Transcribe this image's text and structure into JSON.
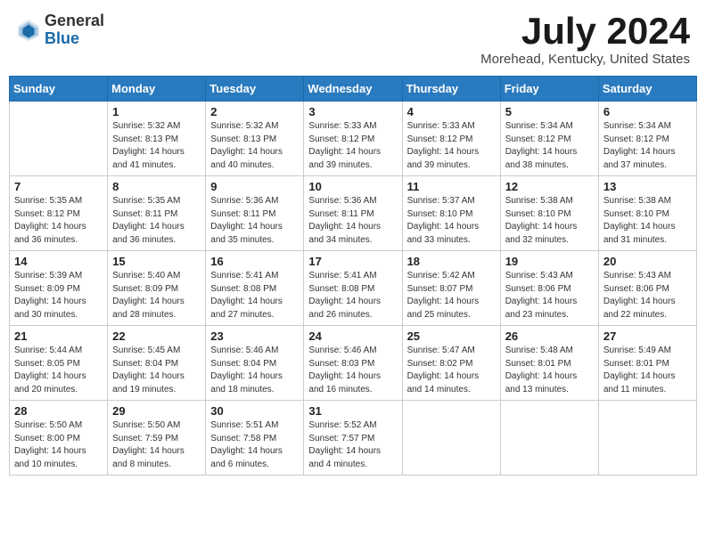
{
  "header": {
    "logo_general": "General",
    "logo_blue": "Blue",
    "month_title": "July 2024",
    "location": "Morehead, Kentucky, United States"
  },
  "days_of_week": [
    "Sunday",
    "Monday",
    "Tuesday",
    "Wednesday",
    "Thursday",
    "Friday",
    "Saturday"
  ],
  "weeks": [
    [
      {
        "day": "",
        "info": ""
      },
      {
        "day": "1",
        "info": "Sunrise: 5:32 AM\nSunset: 8:13 PM\nDaylight: 14 hours\nand 41 minutes."
      },
      {
        "day": "2",
        "info": "Sunrise: 5:32 AM\nSunset: 8:13 PM\nDaylight: 14 hours\nand 40 minutes."
      },
      {
        "day": "3",
        "info": "Sunrise: 5:33 AM\nSunset: 8:12 PM\nDaylight: 14 hours\nand 39 minutes."
      },
      {
        "day": "4",
        "info": "Sunrise: 5:33 AM\nSunset: 8:12 PM\nDaylight: 14 hours\nand 39 minutes."
      },
      {
        "day": "5",
        "info": "Sunrise: 5:34 AM\nSunset: 8:12 PM\nDaylight: 14 hours\nand 38 minutes."
      },
      {
        "day": "6",
        "info": "Sunrise: 5:34 AM\nSunset: 8:12 PM\nDaylight: 14 hours\nand 37 minutes."
      }
    ],
    [
      {
        "day": "7",
        "info": "Sunrise: 5:35 AM\nSunset: 8:12 PM\nDaylight: 14 hours\nand 36 minutes."
      },
      {
        "day": "8",
        "info": "Sunrise: 5:35 AM\nSunset: 8:11 PM\nDaylight: 14 hours\nand 36 minutes."
      },
      {
        "day": "9",
        "info": "Sunrise: 5:36 AM\nSunset: 8:11 PM\nDaylight: 14 hours\nand 35 minutes."
      },
      {
        "day": "10",
        "info": "Sunrise: 5:36 AM\nSunset: 8:11 PM\nDaylight: 14 hours\nand 34 minutes."
      },
      {
        "day": "11",
        "info": "Sunrise: 5:37 AM\nSunset: 8:10 PM\nDaylight: 14 hours\nand 33 minutes."
      },
      {
        "day": "12",
        "info": "Sunrise: 5:38 AM\nSunset: 8:10 PM\nDaylight: 14 hours\nand 32 minutes."
      },
      {
        "day": "13",
        "info": "Sunrise: 5:38 AM\nSunset: 8:10 PM\nDaylight: 14 hours\nand 31 minutes."
      }
    ],
    [
      {
        "day": "14",
        "info": "Sunrise: 5:39 AM\nSunset: 8:09 PM\nDaylight: 14 hours\nand 30 minutes."
      },
      {
        "day": "15",
        "info": "Sunrise: 5:40 AM\nSunset: 8:09 PM\nDaylight: 14 hours\nand 28 minutes."
      },
      {
        "day": "16",
        "info": "Sunrise: 5:41 AM\nSunset: 8:08 PM\nDaylight: 14 hours\nand 27 minutes."
      },
      {
        "day": "17",
        "info": "Sunrise: 5:41 AM\nSunset: 8:08 PM\nDaylight: 14 hours\nand 26 minutes."
      },
      {
        "day": "18",
        "info": "Sunrise: 5:42 AM\nSunset: 8:07 PM\nDaylight: 14 hours\nand 25 minutes."
      },
      {
        "day": "19",
        "info": "Sunrise: 5:43 AM\nSunset: 8:06 PM\nDaylight: 14 hours\nand 23 minutes."
      },
      {
        "day": "20",
        "info": "Sunrise: 5:43 AM\nSunset: 8:06 PM\nDaylight: 14 hours\nand 22 minutes."
      }
    ],
    [
      {
        "day": "21",
        "info": "Sunrise: 5:44 AM\nSunset: 8:05 PM\nDaylight: 14 hours\nand 20 minutes."
      },
      {
        "day": "22",
        "info": "Sunrise: 5:45 AM\nSunset: 8:04 PM\nDaylight: 14 hours\nand 19 minutes."
      },
      {
        "day": "23",
        "info": "Sunrise: 5:46 AM\nSunset: 8:04 PM\nDaylight: 14 hours\nand 18 minutes."
      },
      {
        "day": "24",
        "info": "Sunrise: 5:46 AM\nSunset: 8:03 PM\nDaylight: 14 hours\nand 16 minutes."
      },
      {
        "day": "25",
        "info": "Sunrise: 5:47 AM\nSunset: 8:02 PM\nDaylight: 14 hours\nand 14 minutes."
      },
      {
        "day": "26",
        "info": "Sunrise: 5:48 AM\nSunset: 8:01 PM\nDaylight: 14 hours\nand 13 minutes."
      },
      {
        "day": "27",
        "info": "Sunrise: 5:49 AM\nSunset: 8:01 PM\nDaylight: 14 hours\nand 11 minutes."
      }
    ],
    [
      {
        "day": "28",
        "info": "Sunrise: 5:50 AM\nSunset: 8:00 PM\nDaylight: 14 hours\nand 10 minutes."
      },
      {
        "day": "29",
        "info": "Sunrise: 5:50 AM\nSunset: 7:59 PM\nDaylight: 14 hours\nand 8 minutes."
      },
      {
        "day": "30",
        "info": "Sunrise: 5:51 AM\nSunset: 7:58 PM\nDaylight: 14 hours\nand 6 minutes."
      },
      {
        "day": "31",
        "info": "Sunrise: 5:52 AM\nSunset: 7:57 PM\nDaylight: 14 hours\nand 4 minutes."
      },
      {
        "day": "",
        "info": ""
      },
      {
        "day": "",
        "info": ""
      },
      {
        "day": "",
        "info": ""
      }
    ]
  ]
}
